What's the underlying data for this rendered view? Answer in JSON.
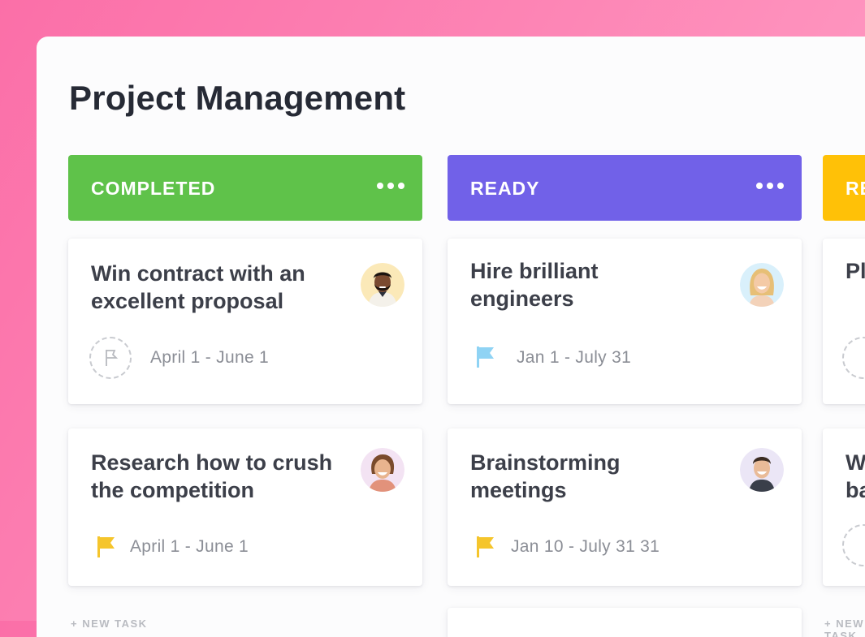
{
  "page_title": "Project Management",
  "columns": [
    {
      "label": "COMPLETED",
      "color": "#5fc24a",
      "cards": [
        {
          "title": "Win contract with an excellent proposal",
          "date": "April 1 - June 1",
          "flag": "none",
          "avatar": "man-dark-beard-avatar"
        },
        {
          "title": "Research how to crush the competition",
          "date": "April 1 - June 1",
          "flag": "yellow",
          "avatar": "woman-smiling-avatar"
        }
      ]
    },
    {
      "label": "READY",
      "color": "#7161e8",
      "cards": [
        {
          "title": "Hire brilliant engineers",
          "date": "Jan 1 - July 31",
          "flag": "blue",
          "avatar": "woman-blonde-avatar"
        },
        {
          "title": "Brainstorming meetings",
          "date": "Jan 10 - July 31 31",
          "flag": "yellow",
          "avatar": "man-smiling-avatar"
        }
      ]
    },
    {
      "label": "RE",
      "color": "#ffc107",
      "cards": [
        {
          "title": "Pl",
          "flag": "none"
        },
        {
          "title": "W\nba",
          "flag": "none"
        }
      ]
    }
  ],
  "new_task_label": "+ NEW TASK",
  "colors": {
    "flag_yellow": "#f5c52c",
    "flag_blue": "#8fd3f4",
    "title": "#262a35",
    "card_text": "#3c3f49",
    "date_text": "#8b8e96"
  }
}
